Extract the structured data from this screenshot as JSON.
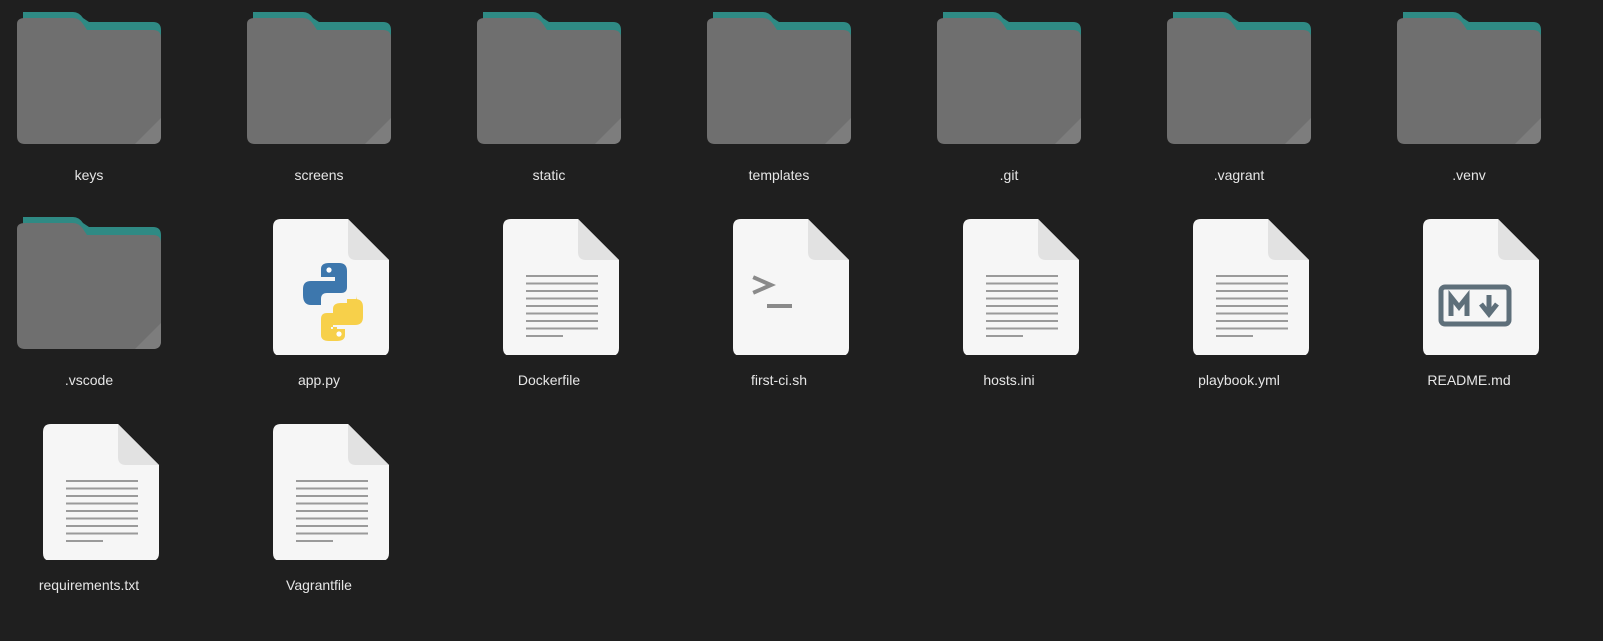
{
  "view": {
    "items": [
      {
        "name": "keys",
        "kind": "folder",
        "icon": "folder-icon"
      },
      {
        "name": "screens",
        "kind": "folder",
        "icon": "folder-icon"
      },
      {
        "name": "static",
        "kind": "folder",
        "icon": "folder-icon"
      },
      {
        "name": "templates",
        "kind": "folder",
        "icon": "folder-icon"
      },
      {
        "name": ".git",
        "kind": "folder",
        "icon": "folder-icon"
      },
      {
        "name": ".vagrant",
        "kind": "folder",
        "icon": "folder-icon"
      },
      {
        "name": ".venv",
        "kind": "folder",
        "icon": "folder-icon"
      },
      {
        "name": ".vscode",
        "kind": "folder",
        "icon": "folder-icon"
      },
      {
        "name": "app.py",
        "kind": "python",
        "icon": "python-file-icon"
      },
      {
        "name": "Dockerfile",
        "kind": "text",
        "icon": "text-file-icon"
      },
      {
        "name": "first-ci.sh",
        "kind": "shell",
        "icon": "shell-script-icon"
      },
      {
        "name": "hosts.ini",
        "kind": "text",
        "icon": "text-file-icon"
      },
      {
        "name": "playbook.yml",
        "kind": "text",
        "icon": "text-file-icon"
      },
      {
        "name": "README.md",
        "kind": "markdown",
        "icon": "markdown-file-icon"
      },
      {
        "name": "requirements.txt",
        "kind": "text",
        "icon": "text-file-icon"
      },
      {
        "name": "Vagrantfile",
        "kind": "text",
        "icon": "text-file-icon"
      }
    ]
  },
  "colors": {
    "background": "#1f1f1f",
    "folder_tab": "#2f8a84",
    "folder_body": "#6f6f6f",
    "file_page": "#f6f6f6",
    "label_text": "#e6e6e6"
  }
}
